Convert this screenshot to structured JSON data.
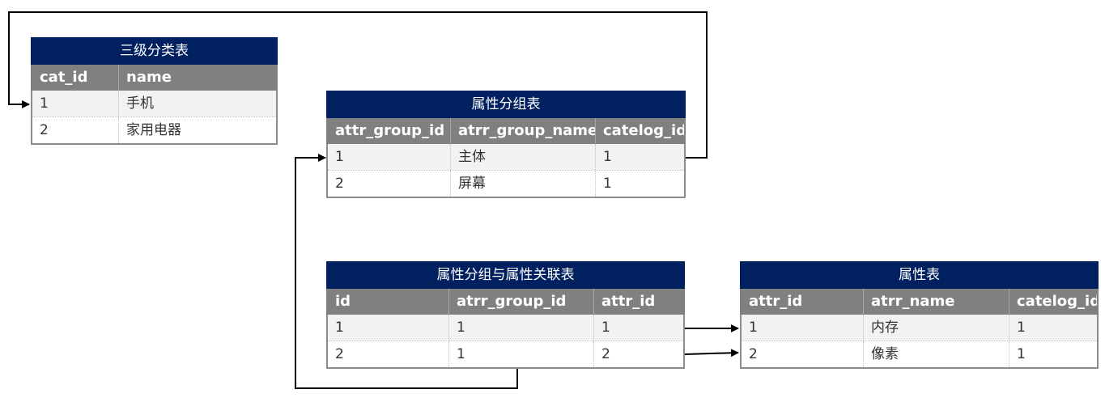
{
  "tables": {
    "category": {
      "title": "三级分类表",
      "headers": [
        "cat_id",
        "name"
      ],
      "rows": [
        [
          "1",
          "手机"
        ],
        [
          "2",
          "家用电器"
        ]
      ]
    },
    "attr_group": {
      "title": "属性分组表",
      "headers": [
        "attr_group_id",
        "atrr_group_name",
        "catelog_id"
      ],
      "rows": [
        [
          "1",
          "主体",
          "1"
        ],
        [
          "2",
          "屏幕",
          "1"
        ]
      ]
    },
    "relation": {
      "title": "属性分组与属性关联表",
      "headers": [
        "id",
        "atrr_group_id",
        "attr_id"
      ],
      "rows": [
        [
          "1",
          "1",
          "1"
        ],
        [
          "2",
          "1",
          "2"
        ]
      ]
    },
    "attr": {
      "title": "属性表",
      "headers": [
        "attr_id",
        "atrr_name",
        "catelog_id"
      ],
      "rows": [
        [
          "1",
          "内存",
          "1"
        ],
        [
          "2",
          "像素",
          "1"
        ]
      ]
    }
  },
  "colors": {
    "title_bar": "#002060",
    "header_bar": "#808080",
    "row_alt": "#f2f2f2",
    "border": "#8c8c8c",
    "connector": "#000000"
  }
}
